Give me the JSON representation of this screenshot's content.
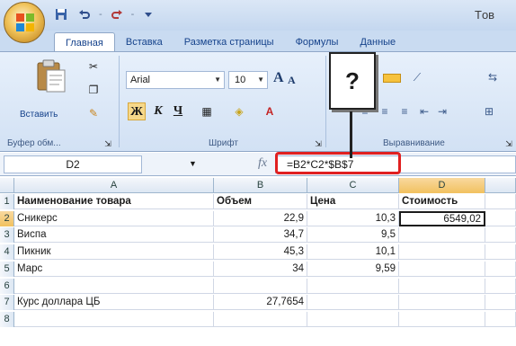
{
  "titlebar": {
    "window_title": "Tов",
    "qat_icons": [
      "save-icon",
      "undo-icon",
      "redo-icon",
      "customize-icon"
    ]
  },
  "tabs": [
    {
      "label": "Главная",
      "active": true
    },
    {
      "label": "Вставка",
      "active": false
    },
    {
      "label": "Разметка страницы",
      "active": false
    },
    {
      "label": "Формулы",
      "active": false
    },
    {
      "label": "Данные",
      "active": false
    }
  ],
  "ribbon": {
    "clipboard": {
      "paste_label": "Вставить",
      "group_label": "Буфер обм..."
    },
    "font": {
      "font_name": "Arial",
      "font_size": "10",
      "bold": "Ж",
      "italic": "К",
      "underline": "Ч",
      "group_label": "Шрифт"
    },
    "alignment": {
      "group_label": "Выравнивание"
    }
  },
  "callout": {
    "text": "?"
  },
  "formula_bar": {
    "name_box": "D2",
    "fx": "fx",
    "formula": "=B2*C2*$B$7"
  },
  "grid": {
    "active_cell": "D2",
    "columns": [
      "A",
      "B",
      "C",
      "D"
    ],
    "rows": [
      {
        "num": "1",
        "a": "Наименование товара",
        "b": "Объем",
        "c": "Цена",
        "d": "Стоимость"
      },
      {
        "num": "2",
        "a": "Сникерс",
        "b": "22,9",
        "c": "10,3",
        "d": "6549,02"
      },
      {
        "num": "3",
        "a": "Виспа",
        "b": "34,7",
        "c": "9,5",
        "d": ""
      },
      {
        "num": "4",
        "a": "Пикник",
        "b": "45,3",
        "c": "10,1",
        "d": ""
      },
      {
        "num": "5",
        "a": "Марс",
        "b": "34",
        "c": "9,59",
        "d": ""
      },
      {
        "num": "6",
        "a": "",
        "b": "",
        "c": "",
        "d": ""
      },
      {
        "num": "7",
        "a": "Курс доллара ЦБ",
        "b": "27,7654",
        "c": "",
        "d": ""
      },
      {
        "num": "8",
        "a": "",
        "b": "",
        "c": "",
        "d": ""
      }
    ]
  },
  "colors": {
    "accent": "#15428b",
    "highlight": "#e02020",
    "selection_header": "#f1c15f"
  }
}
